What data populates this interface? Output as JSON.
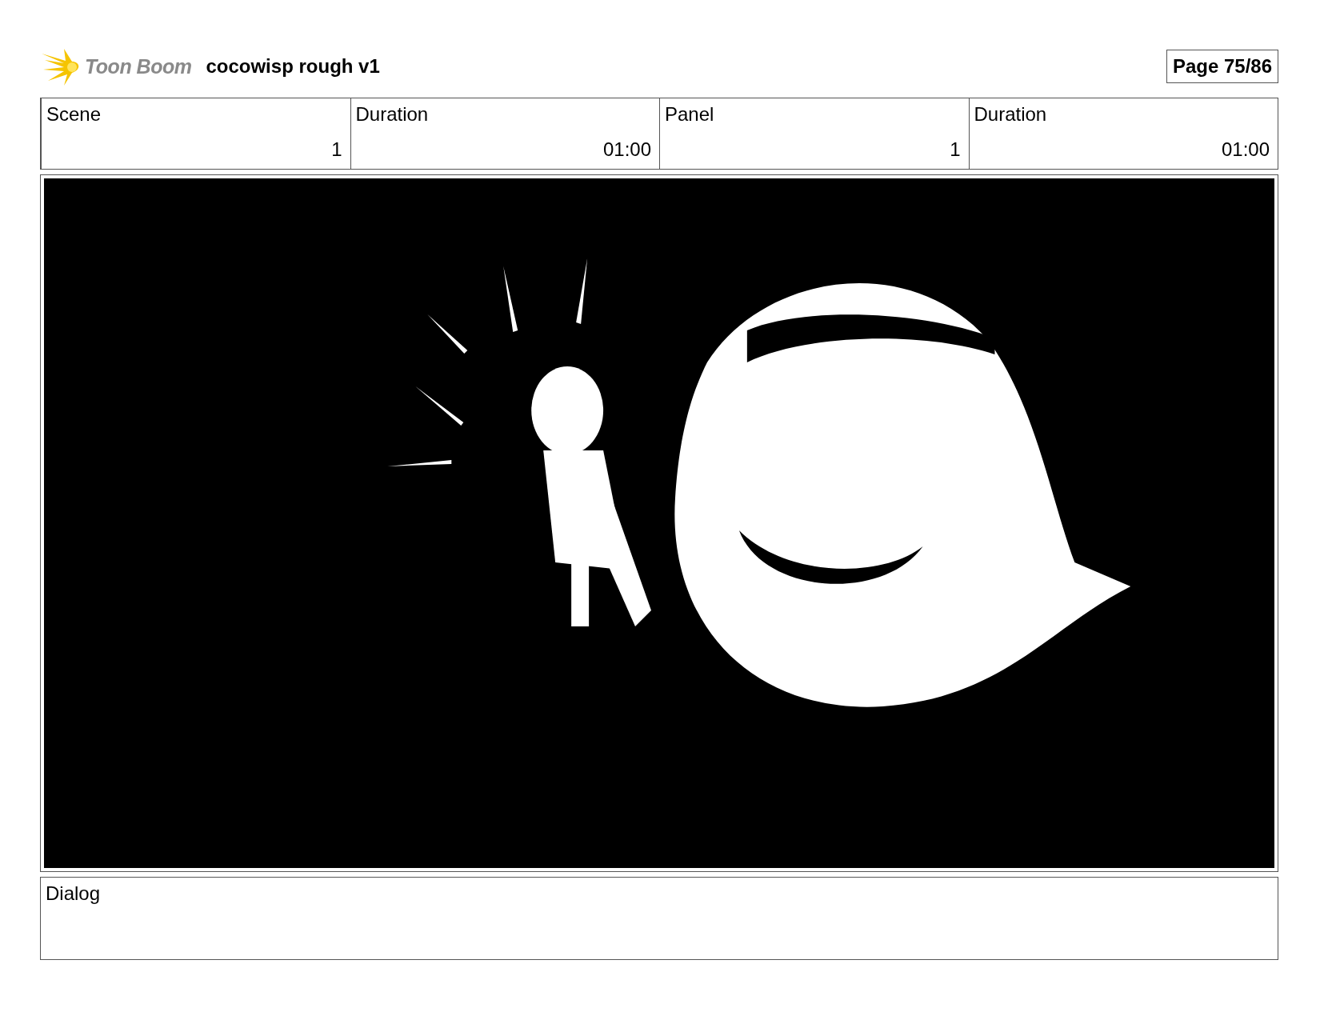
{
  "header": {
    "logo": "Toon Boom",
    "title": "cocowisp rough v1",
    "page": "Page 75/86"
  },
  "info_table": {
    "columns": [
      "Scene",
      "Duration",
      "Panel",
      "Duration"
    ],
    "row": [
      "1",
      "01:00",
      "1",
      "01:00"
    ]
  },
  "dialog": {
    "label": "Dialog"
  }
}
